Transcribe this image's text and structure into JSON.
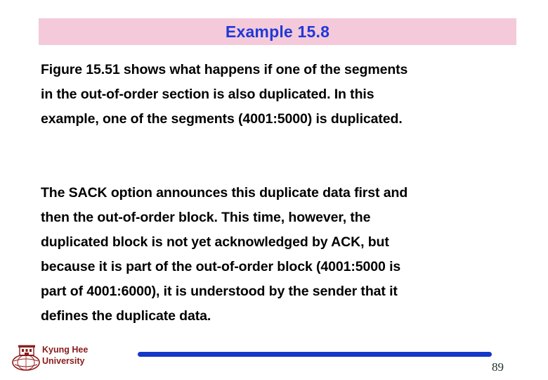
{
  "slide": {
    "title": "Example 15.8",
    "title_bar_color": "#f4cada",
    "title_text_color": "#2039d8",
    "paragraphs": [
      {
        "id": "paragraph-1",
        "lines": [
          "Figure 15.51 shows what happens if one of the segments",
          "in the out-of-order section is also duplicated. In this",
          "example, one of the segments (4001:5000) is duplicated."
        ]
      },
      {
        "id": "paragraph-2",
        "lines": [
          "The SACK option announces this duplicate data first and",
          "then the out-of-order block. This time, however, the",
          "duplicated block is not yet acknowledged by ACK, but",
          "because it is part of the out-of-order block (4001:5000 is",
          "part of 4001:6000), it is understood by the sender that it",
          "defines the duplicate data."
        ]
      }
    ]
  },
  "footer": {
    "university_line1": "Kyung Hee",
    "university_line2": "University",
    "university_color": "#8b1a1a",
    "rule_color": "#1438c8",
    "page_number": "89"
  }
}
